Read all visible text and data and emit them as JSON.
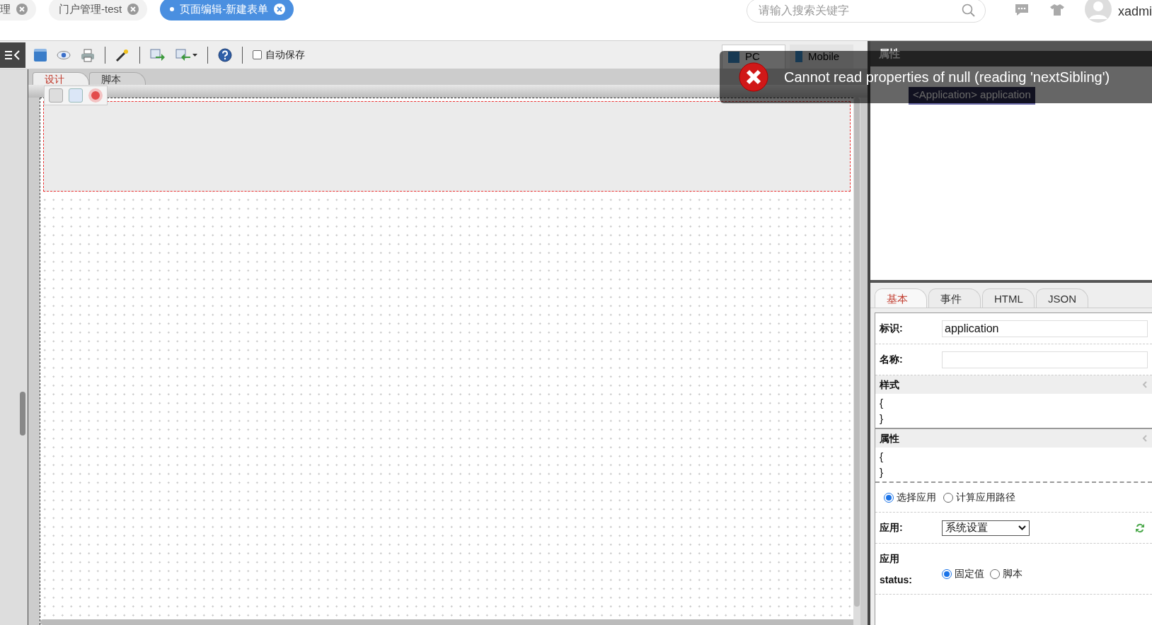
{
  "top_tabs": [
    {
      "label": "理",
      "selected": false
    },
    {
      "label": "门户管理-test",
      "selected": false
    },
    {
      "label": "页面编辑-新建表单",
      "selected": true
    }
  ],
  "search": {
    "placeholder": "请输入搜索关键字"
  },
  "user": {
    "name": "xadmi"
  },
  "toolbar": {
    "autosave": {
      "label": "自动保存",
      "checked": false
    }
  },
  "editor_tabs": [
    {
      "label": "设计",
      "selected": true
    },
    {
      "label": "脚本",
      "selected": false
    }
  ],
  "device_tabs": [
    {
      "label": "PC",
      "selected": true
    },
    {
      "label": "Mobile",
      "selected": false
    }
  ],
  "properties_panel": {
    "title": "属性",
    "tree": [
      {
        "label": "<Application> application",
        "selected": true
      }
    ]
  },
  "property_tabs": [
    {
      "label": "基本",
      "selected": true
    },
    {
      "label": "事件",
      "selected": false
    },
    {
      "label": "HTML",
      "selected": false
    },
    {
      "label": "JSON",
      "selected": false
    }
  ],
  "fields": [
    {
      "label": "标识:",
      "value": "application"
    },
    {
      "label": "名称:"
    }
  ],
  "sections": [
    {
      "title": "样式",
      "lines": [
        "{",
        "}"
      ]
    },
    {
      "title": "属性",
      "lines": [
        "{",
        "}"
      ]
    }
  ],
  "app_source": [
    {
      "label": "选择应用",
      "selected": true
    },
    {
      "label": "计算应用路径",
      "selected": false
    }
  ],
  "app": {
    "label": "应用:",
    "value": "系统设置"
  },
  "status": {
    "label": "应用 status:",
    "options": [
      {
        "label": "固定值",
        "selected": true
      },
      {
        "label": "脚本",
        "selected": false
      }
    ]
  },
  "toast": {
    "message": "Cannot read properties of null (reading 'nextSibling')"
  }
}
